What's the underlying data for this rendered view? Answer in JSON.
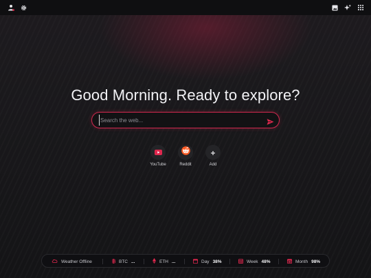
{
  "header": {
    "left_icons": [
      "user-icon",
      "gear-icon"
    ],
    "right_icons": [
      "image-icon",
      "sparkle-icon",
      "apps-grid-icon"
    ]
  },
  "greeting": "Good Morning. Ready to explore?",
  "search": {
    "placeholder": "Search the web...",
    "value": ""
  },
  "shortcuts": [
    {
      "label": "YouTube",
      "icon": "youtube-icon"
    },
    {
      "label": "Reddit",
      "icon": "reddit-icon"
    },
    {
      "label": "Add",
      "icon": "plus-icon"
    }
  ],
  "stats": {
    "weather": {
      "label": "Weather Offline",
      "icon": "cloud-icon"
    },
    "btc": {
      "label": "BTC",
      "value": "...",
      "icon": "bitcoin-icon"
    },
    "eth": {
      "label": "ETH",
      "value": "...",
      "icon": "ethereum-icon"
    },
    "day": {
      "label": "Day",
      "value": "38%",
      "icon": "day-calendar-icon"
    },
    "week": {
      "label": "Week",
      "value": "48%",
      "icon": "week-calendar-icon"
    },
    "month": {
      "label": "Month",
      "value": "98%",
      "icon": "month-calendar-icon"
    }
  },
  "colors": {
    "accent": "#e0284e",
    "background": "#19181b",
    "topbar": "#0f0f11"
  }
}
